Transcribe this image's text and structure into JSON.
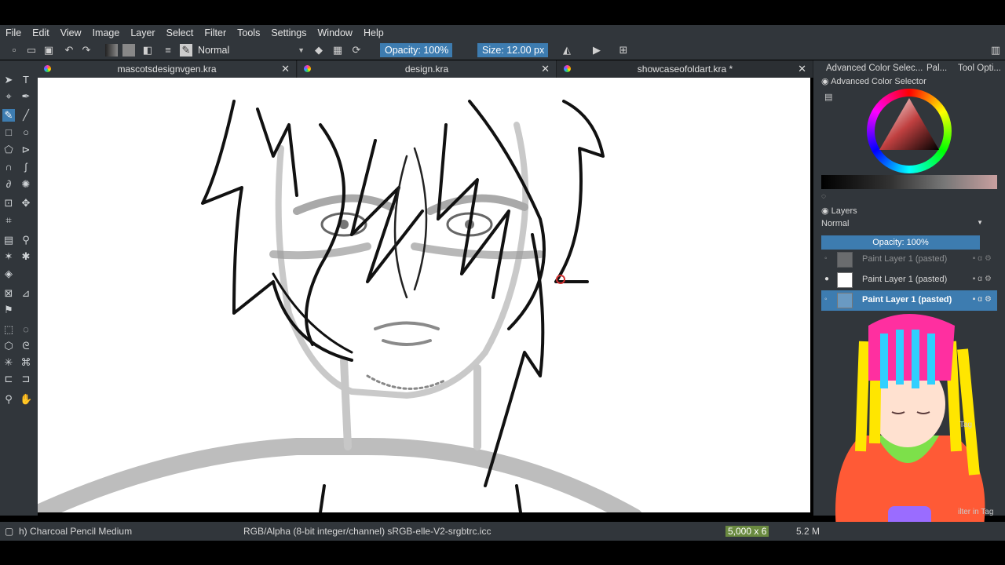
{
  "menu": [
    "File",
    "Edit",
    "View",
    "Image",
    "Layer",
    "Select",
    "Filter",
    "Tools",
    "Settings",
    "Window",
    "Help"
  ],
  "toolbar": {
    "blend_mode": "Normal",
    "opacity": "Opacity: 100%",
    "size": "Size: 12.00 px"
  },
  "tabs": [
    {
      "label": "mascotsdesignvgen.kra"
    },
    {
      "label": "design.kra"
    },
    {
      "label": "showcaseofoldart.kra *"
    }
  ],
  "dock": {
    "tab_labels": [
      "Advanced Color Selec...",
      "Pal...",
      "Tool Opti..."
    ],
    "color_selector_title": "Advanced Color Selector",
    "layers_title": "Layers",
    "layers_blend": "Normal",
    "layers_opacity": "Opacity:  100%",
    "layers": [
      {
        "name": "Paint Layer 1 (pasted)"
      },
      {
        "name": "Paint Layer 1 (pasted)"
      },
      {
        "name": "Paint Layer 1 (pasted)"
      }
    ],
    "tag_label": "Tag",
    "filter_tag_label": "ilter in Tag"
  },
  "status": {
    "brush": "h) Charcoal Pencil Medium",
    "color_space": "RGB/Alpha (8-bit integer/channel)  sRGB-elle-V2-srgbtrc.icc",
    "dimensions": "5,000 x 6",
    "memory": "5.2 M"
  },
  "colors": {
    "ui_bg": "#31363b",
    "accent": "#3d7cb0",
    "canvas": "#ffffff"
  }
}
